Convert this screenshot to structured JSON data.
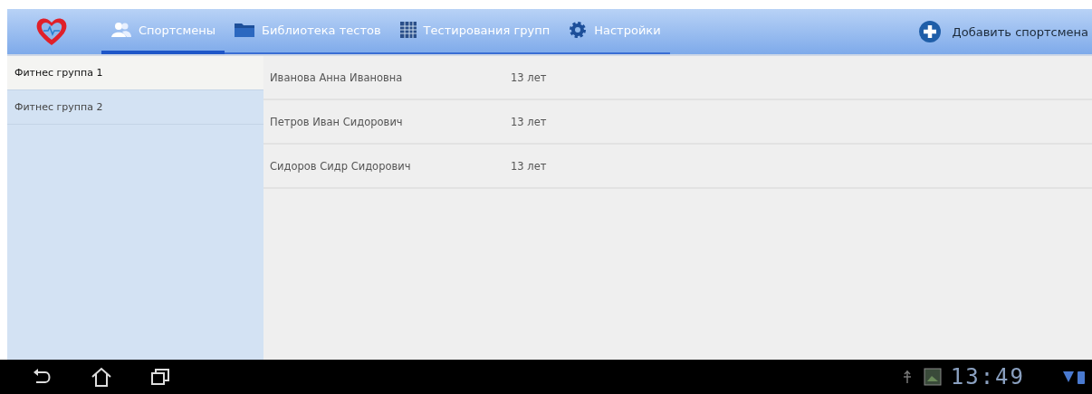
{
  "tabs": [
    {
      "label": "Спортсмены",
      "kind": "people",
      "selected": true
    },
    {
      "label": "Библиотека тестов",
      "kind": "folder",
      "selected": false
    },
    {
      "label": "Тестирования групп",
      "kind": "grid",
      "selected": false
    },
    {
      "label": "Настройки",
      "kind": "gear",
      "selected": false
    }
  ],
  "add_button": {
    "label": "Добавить спортсмена"
  },
  "groups": [
    {
      "label": "Фитнес группа 1",
      "selected": true
    },
    {
      "label": "Фитнес группа 2",
      "selected": false
    }
  ],
  "athletes": [
    {
      "name": "Иванова Анна Ивановна",
      "age": "13 лет"
    },
    {
      "name": "Петров Иван Сидорович",
      "age": "13 лет"
    },
    {
      "name": "Сидоров Сидр Сидорович",
      "age": "13 лет"
    }
  ],
  "status_bar": {
    "time": "13:49"
  }
}
